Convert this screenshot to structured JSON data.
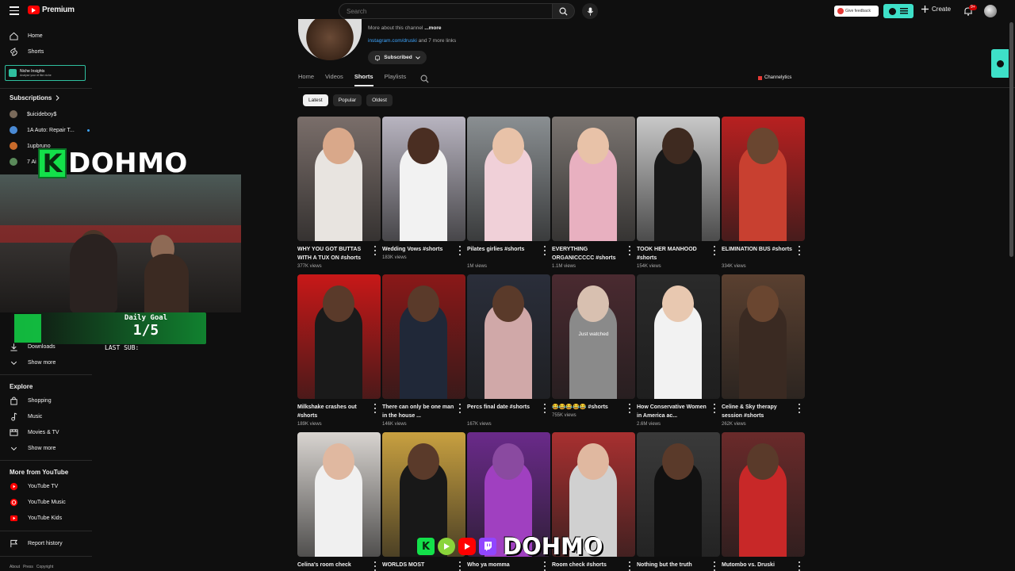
{
  "header": {
    "logo_text": "Premium",
    "search_placeholder": "Search",
    "feedback_label": "Give feedback",
    "create_label": "Create",
    "notif_count": "9+"
  },
  "sidebar": {
    "home": "Home",
    "shorts": "Shorts",
    "niche_title": "Niche Insights",
    "niche_sub": "Analyse your et like niche",
    "subscriptions_head": "Subscriptions",
    "subs": [
      {
        "name": "$uicideboy$",
        "color": "#7a6a5a"
      },
      {
        "name": "1A Auto: Repair T...",
        "color": "#4a8ad4"
      },
      {
        "name": "1upbruno",
        "color": "#c86a2a"
      },
      {
        "name": "7 Ai",
        "color": "#5a8a5a"
      }
    ],
    "downloads": "Downloads",
    "show_more_1": "Show more",
    "explore_head": "Explore",
    "shopping": "Shopping",
    "music": "Music",
    "movies": "Movies & TV",
    "show_more_2": "Show more",
    "more_head": "More from YouTube",
    "yt_tv": "YouTube TV",
    "yt_music": "YouTube Music",
    "yt_kids": "YouTube Kids",
    "report": "Report history",
    "footer": [
      "About",
      "Press",
      "Copyright"
    ]
  },
  "overlay": {
    "k": "K",
    "dohmo": "DOHMO",
    "goal_title": "Daily Goal",
    "goal_value": "1/5",
    "last_sub": "LAST SUB:"
  },
  "channel": {
    "about": "More about this channel",
    "about_more": "...more",
    "link": "instagram.com/druski",
    "link_more": "and 7 more links",
    "subscribed": "Subscribed",
    "tabs": [
      "Home",
      "Videos",
      "Shorts",
      "Playlists"
    ],
    "active_tab": "Shorts",
    "channelytics": "Channelytics",
    "chips": [
      "Latest",
      "Popular",
      "Oldest"
    ],
    "active_chip": "Latest"
  },
  "shorts": [
    {
      "title": "WHY YOU GOT BUTTAS WITH A TUX ON #shorts",
      "views": "377K views",
      "bg": "#7a6e6a",
      "skin": "#d9a88a",
      "cloth": "#e8e4e0"
    },
    {
      "title": "Wedding Vows #shorts",
      "views": "183K views",
      "bg": "#b8b4c0",
      "skin": "#4a2e22",
      "cloth": "#f2f2f2"
    },
    {
      "title": "Pilates girlies #shorts",
      "views": "1M views",
      "bg": "#8a8f92",
      "skin": "#e8c2a8",
      "cloth": "#f0d0d8"
    },
    {
      "title": "EVERYTHING ORGANICCCCC #shorts",
      "views": "1.1M views",
      "bg": "#7a7470",
      "skin": "#e8c2a8",
      "cloth": "#e8b0c0"
    },
    {
      "title": "TOOK HER MANHOOD #shorts",
      "views": "154K views",
      "bg": "#c8c8c8",
      "skin": "#3e2a20",
      "cloth": "#181818"
    },
    {
      "title": "ELIMINATION BUS #shorts",
      "views": "334K views",
      "bg": "#b82020",
      "skin": "#6a4630",
      "cloth": "#c84030"
    },
    {
      "title": "Milkshake crashes out #shorts",
      "views": "189K views",
      "bg": "#c81818",
      "skin": "#5a3a2a",
      "cloth": "#1a1a1a"
    },
    {
      "title": "There can only be one man in the house ...",
      "views": "146K views",
      "bg": "#8a1818",
      "skin": "#5a3a2a",
      "cloth": "#202838"
    },
    {
      "title": "Percs final date #shorts",
      "views": "167K views",
      "bg": "#2a2e3a",
      "skin": "#5a3a2a",
      "cloth": "#d0a8a8"
    },
    {
      "title": "😂😂😂😂😂 #shorts",
      "views": "755K views",
      "bg": "#4a2a30",
      "skin": "#d8c0b0",
      "cloth": "#8a8a8a",
      "overlay": "Just watched"
    },
    {
      "title": "How Conservative Women in America ac...",
      "views": "2.6M views",
      "bg": "#2a2a2a",
      "skin": "#e8c8b0",
      "cloth": "#f2f2f2"
    },
    {
      "title": "Celine & Sky therapy session #shorts",
      "views": "262K views",
      "bg": "#5a4030",
      "skin": "#6a4630",
      "cloth": "#3a2a22"
    },
    {
      "title": "Celina's room check",
      "views": "",
      "bg": "#d8d4d0",
      "skin": "#e0b8a0",
      "cloth": "#f0f0f0"
    },
    {
      "title": "WORLDS MOST",
      "views": "",
      "bg": "#c8a040",
      "skin": "#5a3a2a",
      "cloth": "#181818"
    },
    {
      "title": "Who ya momma",
      "views": "",
      "bg": "#6a2a8a",
      "skin": "#8a4aa0",
      "cloth": "#a040c0"
    },
    {
      "title": "Room check #shorts",
      "views": "",
      "bg": "#a83030",
      "skin": "#e0b8a0",
      "cloth": "#d0d0d0"
    },
    {
      "title": "Nothing but the truth",
      "views": "",
      "bg": "#3a3a3a",
      "skin": "#5a3a2a",
      "cloth": "#111111"
    },
    {
      "title": "Mutombo vs. Druski",
      "views": "",
      "bg": "#6a2a2a",
      "skin": "#5a3a2a",
      "cloth": "#c82828"
    }
  ],
  "stream_bar": {
    "dohmo": "DOHMO"
  }
}
